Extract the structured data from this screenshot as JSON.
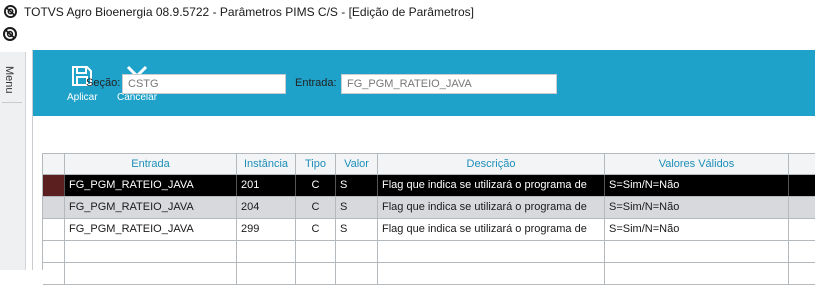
{
  "window": {
    "title": "TOTVS Agro Bioenergia 08.9.5722 - Parâmetros PIMS C/S - [Edição de Parâmetros]"
  },
  "sidebar": {
    "menu_label": "Menu"
  },
  "toolbar": {
    "apply_label": "Aplicar",
    "cancel_label": "Cancelar",
    "accent_color": "#1fa2c9"
  },
  "form": {
    "secao_label": "Seção:",
    "secao_value": "CSTG",
    "entrada_label": "Entrada:",
    "entrada_value": "FG_PGM_RATEIO_JAVA"
  },
  "grid": {
    "columns": [
      "Entrada",
      "Instância",
      "Tipo",
      "Valor",
      "Descrição",
      "Valores Válidos"
    ],
    "rows": [
      {
        "entrada": "FG_PGM_RATEIO_JAVA",
        "instancia": "201",
        "tipo": "C",
        "valor": "S",
        "descricao": "Flag que indica se utilizará o programa de",
        "validos": "S=Sim/N=Não",
        "state": "selected"
      },
      {
        "entrada": "FG_PGM_RATEIO_JAVA",
        "instancia": "204",
        "tipo": "C",
        "valor": "S",
        "descricao": "Flag que indica se utilizará o programa de",
        "validos": "S=Sim/N=Não",
        "state": "alt"
      },
      {
        "entrada": "FG_PGM_RATEIO_JAVA",
        "instancia": "299",
        "tipo": "C",
        "valor": "S",
        "descricao": "Flag que indica se utilizará o programa de",
        "validos": "S=Sim/N=Não",
        "state": "normal"
      }
    ],
    "header_text_color": "#1d8fb8",
    "selected_row_color": "#000000"
  }
}
